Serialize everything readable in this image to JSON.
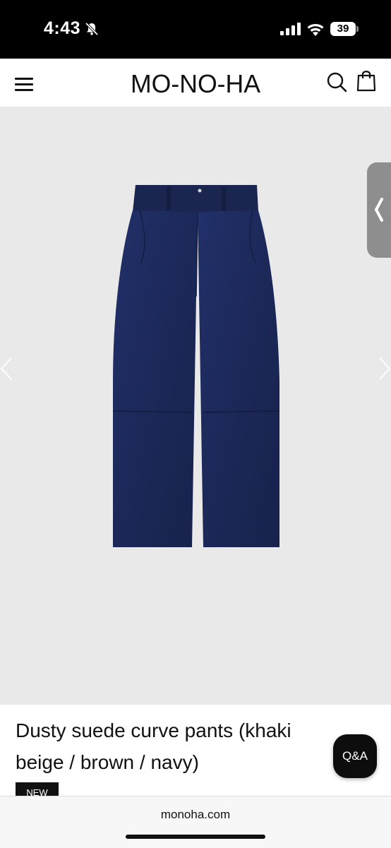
{
  "status_bar": {
    "time": "4:43",
    "battery": "39",
    "icons": [
      "bell-slash-icon",
      "cellular-signal-icon",
      "wifi-icon",
      "battery-icon"
    ]
  },
  "header": {
    "logo_text": "MO-NO-HA",
    "icons": [
      "hamburger-menu-icon",
      "search-icon",
      "shopping-bag-icon"
    ]
  },
  "product": {
    "title": "Dusty suede curve pants (khaki beige / brown / navy)",
    "badge": "NEW",
    "image": "navy suede pants",
    "colors": {
      "pants": "#1f2c5e",
      "background": "#e9e9e9"
    }
  },
  "qa_button": {
    "label": "Q&A"
  },
  "browser": {
    "url": "monoha.com"
  }
}
